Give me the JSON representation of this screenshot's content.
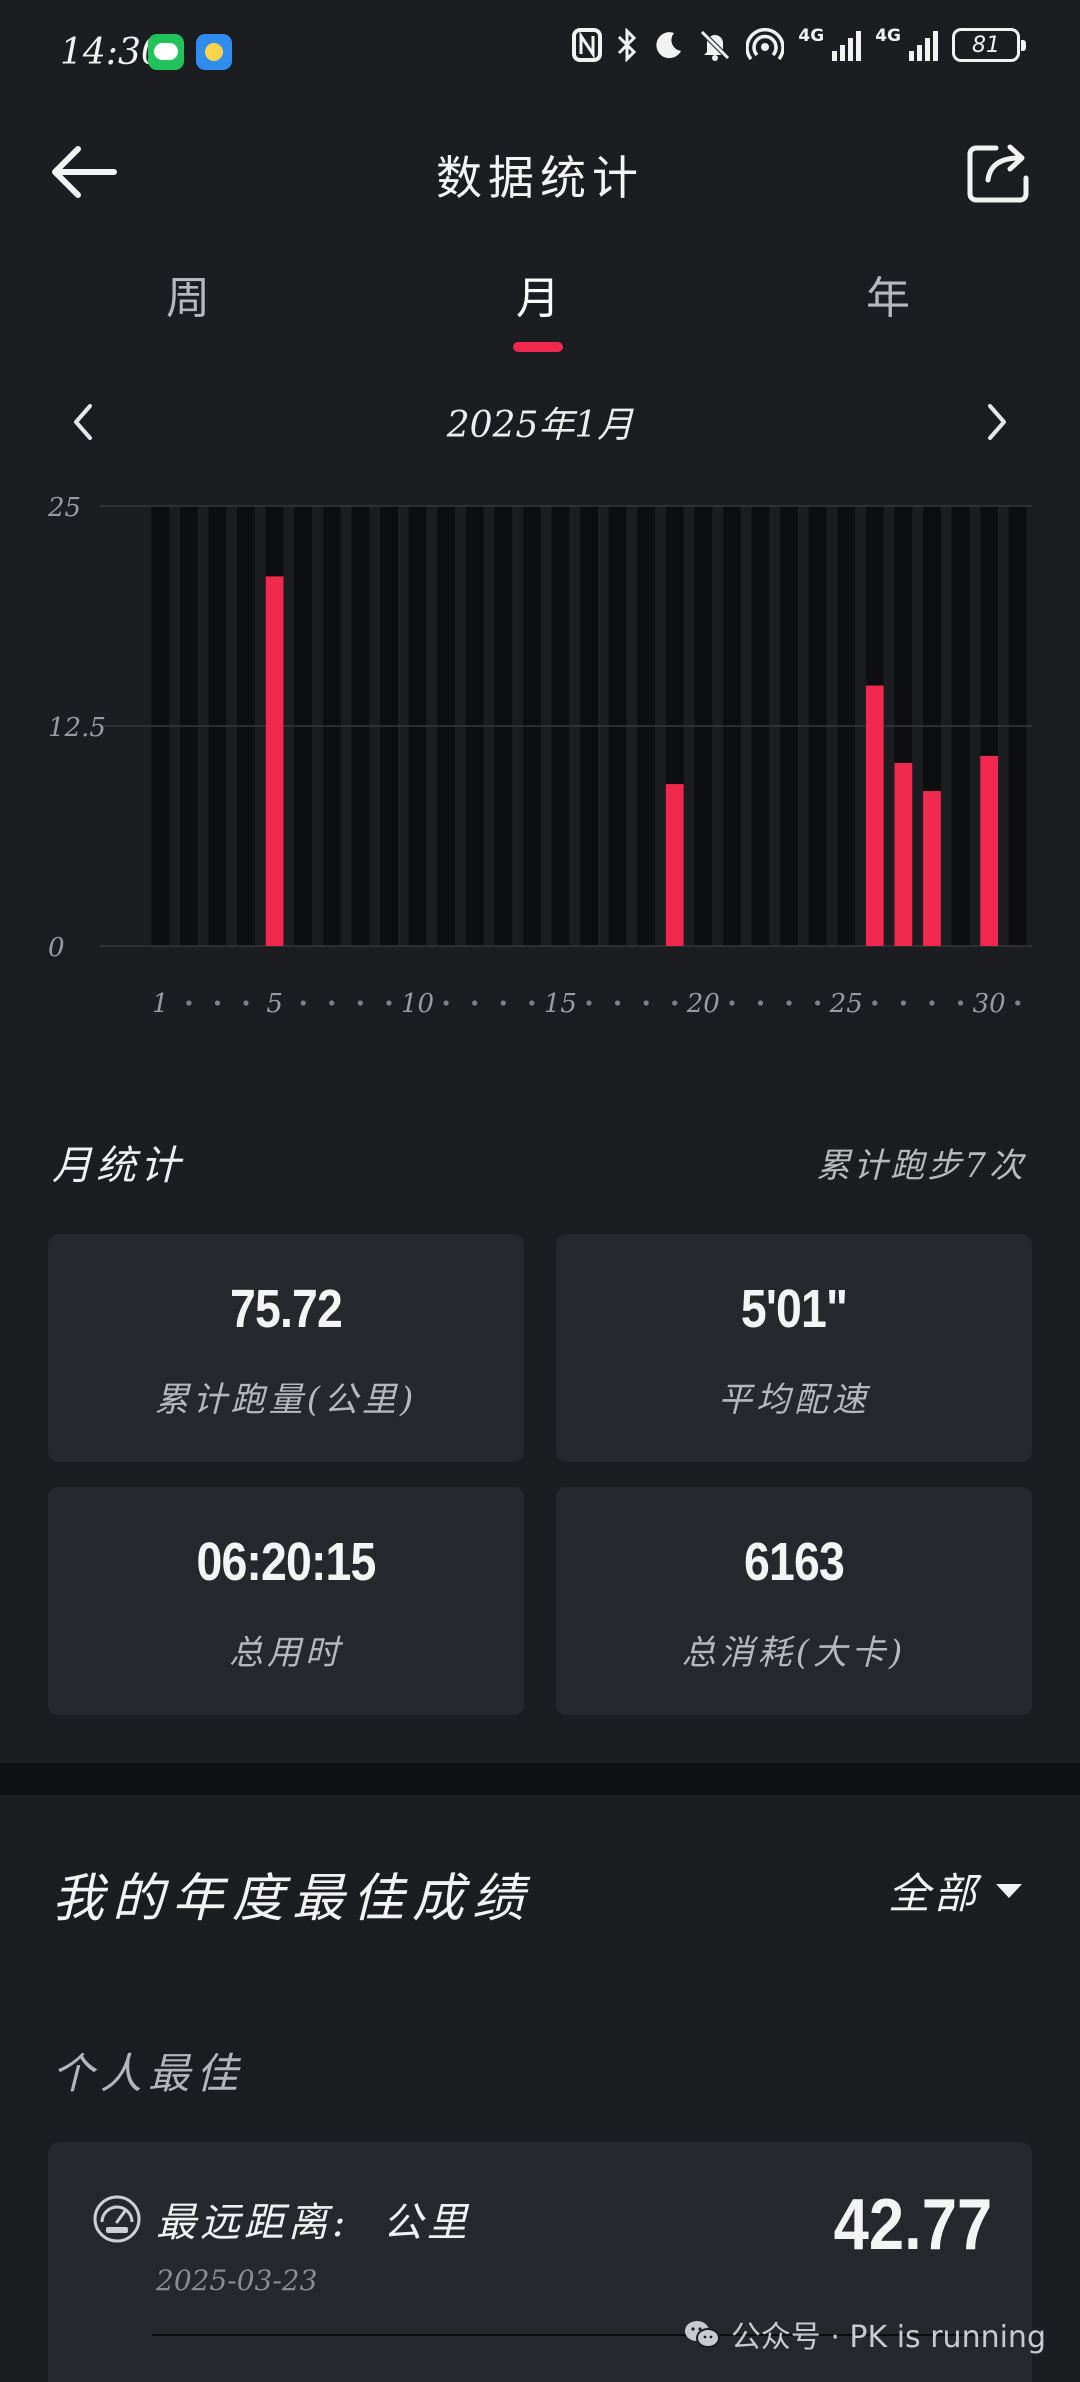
{
  "status_bar": {
    "time": "14:30",
    "network_1": "4G",
    "network_2": "4G",
    "battery": "81",
    "icons": [
      "wechat-icon",
      "weather-icon",
      "nfc-icon",
      "bluetooth-icon",
      "moon-icon",
      "mute-icon",
      "hotspot-icon"
    ]
  },
  "header": {
    "title": "数据统计",
    "back_icon": "arrow-left-icon",
    "share_icon": "share-icon"
  },
  "tabs": [
    {
      "label": "周",
      "active": false
    },
    {
      "label": "月",
      "active": true
    },
    {
      "label": "年",
      "active": false
    }
  ],
  "month_nav": {
    "label": "2025年1月"
  },
  "accent_color": "#f2294f",
  "chart_data": {
    "type": "bar",
    "x": [
      1,
      2,
      3,
      4,
      5,
      6,
      7,
      8,
      9,
      10,
      11,
      12,
      13,
      14,
      15,
      16,
      17,
      18,
      19,
      20,
      21,
      22,
      23,
      24,
      25,
      26,
      27,
      28,
      29,
      30,
      31
    ],
    "values": [
      0,
      0,
      0,
      0,
      21,
      0,
      0,
      0,
      0,
      0,
      0,
      0,
      0,
      0,
      0,
      0,
      0,
      0,
      9.2,
      0,
      0,
      0,
      0,
      0,
      0,
      14.8,
      10.4,
      8.8,
      0,
      10.8,
      0
    ],
    "ylim": [
      0,
      25
    ],
    "yticks": [
      "25",
      "12.5",
      "0"
    ],
    "xtick_labels": [
      "1",
      "5",
      "10",
      "15",
      "20",
      "25",
      "30"
    ],
    "grid": true,
    "color": "#f2294f"
  },
  "month_stats": {
    "title": "月统计",
    "run_count": "累计跑步7次",
    "cards": [
      {
        "value": "75.72",
        "label": "累计跑量(公里)"
      },
      {
        "value": "5'01\"",
        "label": "平均配速"
      },
      {
        "value": "06:20:15",
        "label": "总用时"
      },
      {
        "value": "6163",
        "label": "总消耗(大卡)"
      }
    ]
  },
  "year_best": {
    "title": "我的年度最佳成绩",
    "filter": "全部",
    "section": "个人最佳",
    "record": {
      "label": "最远距离:  公里",
      "date": "2025-03-23",
      "value": "42.77",
      "icon": "dashboard-icon"
    }
  },
  "watermark": {
    "text": "公众号 · PK is running",
    "icon": "wechat-logo-icon"
  }
}
